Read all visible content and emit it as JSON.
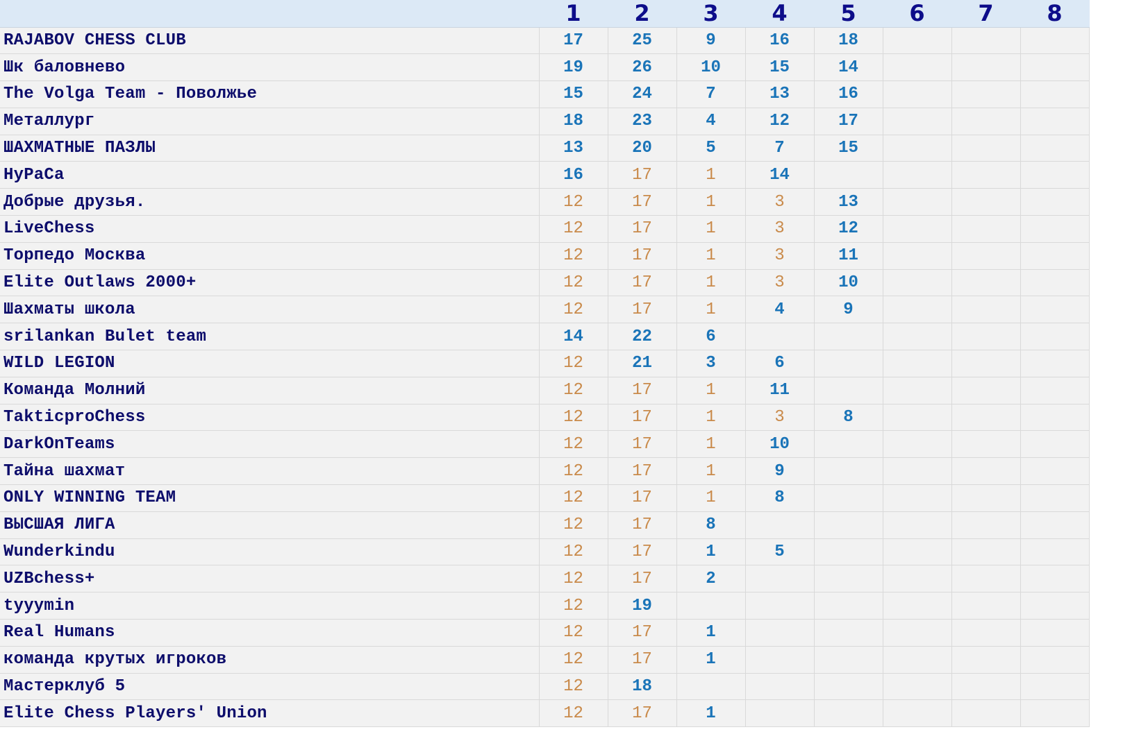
{
  "columns": [
    "1",
    "2",
    "3",
    "4",
    "5",
    "6",
    "7",
    "8"
  ],
  "colors": {
    "header_bg": "#dce9f6",
    "header_text": "#0d0d8a",
    "team_text": "#0d0d6b",
    "score_blue": "#1a74b8",
    "score_orange": "#c98a4a",
    "table_bg": "#f2f2f2"
  },
  "rows": [
    {
      "team": "RAJABOV CHESS CLUB",
      "scores": [
        {
          "v": "17",
          "c": "blue"
        },
        {
          "v": "25",
          "c": "blue"
        },
        {
          "v": "9",
          "c": "blue"
        },
        {
          "v": "16",
          "c": "blue"
        },
        {
          "v": "18",
          "c": "blue"
        },
        null,
        null,
        null
      ]
    },
    {
      "team": "Шк баловнево",
      "scores": [
        {
          "v": "19",
          "c": "blue"
        },
        {
          "v": "26",
          "c": "blue"
        },
        {
          "v": "10",
          "c": "blue"
        },
        {
          "v": "15",
          "c": "blue"
        },
        {
          "v": "14",
          "c": "blue"
        },
        null,
        null,
        null
      ]
    },
    {
      "team": "The Volga Team - Поволжье",
      "scores": [
        {
          "v": "15",
          "c": "blue"
        },
        {
          "v": "24",
          "c": "blue"
        },
        {
          "v": "7",
          "c": "blue"
        },
        {
          "v": "13",
          "c": "blue"
        },
        {
          "v": "16",
          "c": "blue"
        },
        null,
        null,
        null
      ]
    },
    {
      "team": "Металлург",
      "scores": [
        {
          "v": "18",
          "c": "blue"
        },
        {
          "v": "23",
          "c": "blue"
        },
        {
          "v": "4",
          "c": "blue"
        },
        {
          "v": "12",
          "c": "blue"
        },
        {
          "v": "17",
          "c": "blue"
        },
        null,
        null,
        null
      ]
    },
    {
      "team": "ШАХМАТНЫЕ ПАЗЛЫ",
      "scores": [
        {
          "v": "13",
          "c": "blue"
        },
        {
          "v": "20",
          "c": "blue"
        },
        {
          "v": "5",
          "c": "blue"
        },
        {
          "v": "7",
          "c": "blue"
        },
        {
          "v": "15",
          "c": "blue"
        },
        null,
        null,
        null
      ]
    },
    {
      "team": "HyPaCa",
      "scores": [
        {
          "v": "16",
          "c": "blue"
        },
        {
          "v": "17",
          "c": "orange"
        },
        {
          "v": "1",
          "c": "orange"
        },
        {
          "v": "14",
          "c": "blue"
        },
        null,
        null,
        null,
        null
      ]
    },
    {
      "team": "Добрые друзья.",
      "scores": [
        {
          "v": "12",
          "c": "orange"
        },
        {
          "v": "17",
          "c": "orange"
        },
        {
          "v": "1",
          "c": "orange"
        },
        {
          "v": "3",
          "c": "orange"
        },
        {
          "v": "13",
          "c": "blue"
        },
        null,
        null,
        null
      ]
    },
    {
      "team": "LiveChess",
      "scores": [
        {
          "v": "12",
          "c": "orange"
        },
        {
          "v": "17",
          "c": "orange"
        },
        {
          "v": "1",
          "c": "orange"
        },
        {
          "v": "3",
          "c": "orange"
        },
        {
          "v": "12",
          "c": "blue"
        },
        null,
        null,
        null
      ]
    },
    {
      "team": "Торпедо Москва",
      "scores": [
        {
          "v": "12",
          "c": "orange"
        },
        {
          "v": "17",
          "c": "orange"
        },
        {
          "v": "1",
          "c": "orange"
        },
        {
          "v": "3",
          "c": "orange"
        },
        {
          "v": "11",
          "c": "blue"
        },
        null,
        null,
        null
      ]
    },
    {
      "team": "Elite Outlaws 2000+",
      "scores": [
        {
          "v": "12",
          "c": "orange"
        },
        {
          "v": "17",
          "c": "orange"
        },
        {
          "v": "1",
          "c": "orange"
        },
        {
          "v": "3",
          "c": "orange"
        },
        {
          "v": "10",
          "c": "blue"
        },
        null,
        null,
        null
      ]
    },
    {
      "team": "Шахматы школа",
      "scores": [
        {
          "v": "12",
          "c": "orange"
        },
        {
          "v": "17",
          "c": "orange"
        },
        {
          "v": "1",
          "c": "orange"
        },
        {
          "v": "4",
          "c": "blue"
        },
        {
          "v": "9",
          "c": "blue"
        },
        null,
        null,
        null
      ]
    },
    {
      "team": "srilankan Bulet team",
      "scores": [
        {
          "v": "14",
          "c": "blue"
        },
        {
          "v": "22",
          "c": "blue"
        },
        {
          "v": "6",
          "c": "blue"
        },
        null,
        null,
        null,
        null,
        null
      ]
    },
    {
      "team": "WILD LEGION",
      "scores": [
        {
          "v": "12",
          "c": "orange"
        },
        {
          "v": "21",
          "c": "blue"
        },
        {
          "v": "3",
          "c": "blue"
        },
        {
          "v": "6",
          "c": "blue"
        },
        null,
        null,
        null,
        null
      ]
    },
    {
      "team": "Команда Молний",
      "scores": [
        {
          "v": "12",
          "c": "orange"
        },
        {
          "v": "17",
          "c": "orange"
        },
        {
          "v": "1",
          "c": "orange"
        },
        {
          "v": "11",
          "c": "blue"
        },
        null,
        null,
        null,
        null
      ]
    },
    {
      "team": "TakticproChess",
      "scores": [
        {
          "v": "12",
          "c": "orange"
        },
        {
          "v": "17",
          "c": "orange"
        },
        {
          "v": "1",
          "c": "orange"
        },
        {
          "v": "3",
          "c": "orange"
        },
        {
          "v": "8",
          "c": "blue"
        },
        null,
        null,
        null
      ]
    },
    {
      "team": "DarkOnTeams",
      "scores": [
        {
          "v": "12",
          "c": "orange"
        },
        {
          "v": "17",
          "c": "orange"
        },
        {
          "v": "1",
          "c": "orange"
        },
        {
          "v": "10",
          "c": "blue"
        },
        null,
        null,
        null,
        null
      ]
    },
    {
      "team": "Тайна шахмат",
      "scores": [
        {
          "v": "12",
          "c": "orange"
        },
        {
          "v": "17",
          "c": "orange"
        },
        {
          "v": "1",
          "c": "orange"
        },
        {
          "v": "9",
          "c": "blue"
        },
        null,
        null,
        null,
        null
      ]
    },
    {
      "team": "ONLY WINNING TEAM",
      "scores": [
        {
          "v": "12",
          "c": "orange"
        },
        {
          "v": "17",
          "c": "orange"
        },
        {
          "v": "1",
          "c": "orange"
        },
        {
          "v": "8",
          "c": "blue"
        },
        null,
        null,
        null,
        null
      ]
    },
    {
      "team": "ВЫСШАЯ ЛИГА",
      "scores": [
        {
          "v": "12",
          "c": "orange"
        },
        {
          "v": "17",
          "c": "orange"
        },
        {
          "v": "8",
          "c": "blue"
        },
        null,
        null,
        null,
        null,
        null
      ]
    },
    {
      "team": "Wunderkindu",
      "scores": [
        {
          "v": "12",
          "c": "orange"
        },
        {
          "v": "17",
          "c": "orange"
        },
        {
          "v": "1",
          "c": "blue"
        },
        {
          "v": "5",
          "c": "blue"
        },
        null,
        null,
        null,
        null
      ]
    },
    {
      "team": "UZBchess+",
      "scores": [
        {
          "v": "12",
          "c": "orange"
        },
        {
          "v": "17",
          "c": "orange"
        },
        {
          "v": "2",
          "c": "blue"
        },
        null,
        null,
        null,
        null,
        null
      ]
    },
    {
      "team": "tyyymin",
      "scores": [
        {
          "v": "12",
          "c": "orange"
        },
        {
          "v": "19",
          "c": "blue"
        },
        null,
        null,
        null,
        null,
        null,
        null
      ]
    },
    {
      "team": "Real Humans",
      "scores": [
        {
          "v": "12",
          "c": "orange"
        },
        {
          "v": "17",
          "c": "orange"
        },
        {
          "v": "1",
          "c": "blue"
        },
        null,
        null,
        null,
        null,
        null
      ]
    },
    {
      "team": "команда крутых игроков",
      "scores": [
        {
          "v": "12",
          "c": "orange"
        },
        {
          "v": "17",
          "c": "orange"
        },
        {
          "v": "1",
          "c": "blue"
        },
        null,
        null,
        null,
        null,
        null
      ]
    },
    {
      "team": "Мастерклуб 5",
      "scores": [
        {
          "v": "12",
          "c": "orange"
        },
        {
          "v": "18",
          "c": "blue"
        },
        null,
        null,
        null,
        null,
        null,
        null
      ]
    },
    {
      "team": "Elite Chess Players' Union",
      "scores": [
        {
          "v": "12",
          "c": "orange"
        },
        {
          "v": "17",
          "c": "orange"
        },
        {
          "v": "1",
          "c": "blue"
        },
        null,
        null,
        null,
        null,
        null
      ]
    }
  ]
}
